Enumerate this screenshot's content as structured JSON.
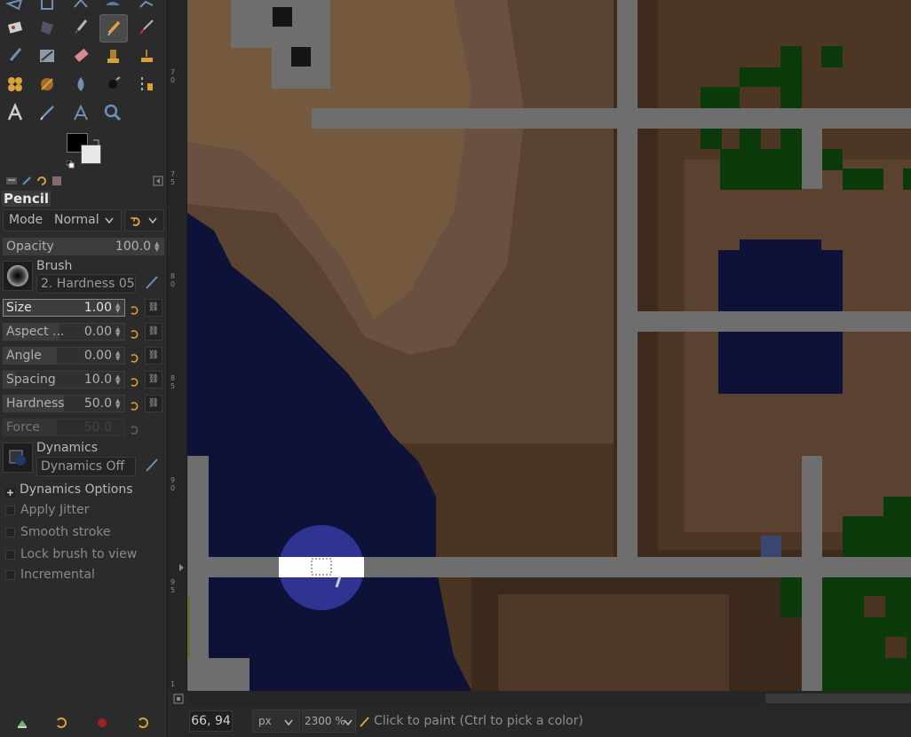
{
  "tool_options": {
    "title": "Pencil",
    "mode_label": "Mode",
    "mode_value": "Normal",
    "opacity": {
      "label": "Opacity",
      "value": "100.0"
    },
    "brush": {
      "label": "Brush",
      "value": "2. Hardness 05"
    },
    "params": [
      {
        "label": "Size",
        "value": "1.00",
        "selected": true
      },
      {
        "label": "Aspect ...",
        "value": "0.00"
      },
      {
        "label": "Angle",
        "value": "0.00"
      },
      {
        "label": "Spacing",
        "value": "10.0"
      },
      {
        "label": "Hardness",
        "value": "50.0"
      },
      {
        "label": "Force",
        "value": "50.0"
      }
    ],
    "dynamics": {
      "label": "Dynamics",
      "value": "Dynamics Off"
    },
    "dynamics_options_label": "Dynamics Options",
    "checkboxes": [
      "Apply Jitter",
      "Smooth stroke",
      "Lock brush to view",
      "Incremental"
    ]
  },
  "ruler_labels": [
    "7\n0",
    "7\n5",
    "8\n0",
    "8\n5",
    "9\n0",
    "9\n5",
    "1"
  ],
  "status": {
    "coords": "66, 94",
    "unit": "px",
    "zoom": "2300 %",
    "message": "Click to paint (Ctrl to pick a color)"
  },
  "colors": {
    "accent": "#d9a13a",
    "water": "#0f1238",
    "road": "#6e6e6e",
    "grass": "#0b3a0b",
    "dirt": "#6a4a30"
  }
}
